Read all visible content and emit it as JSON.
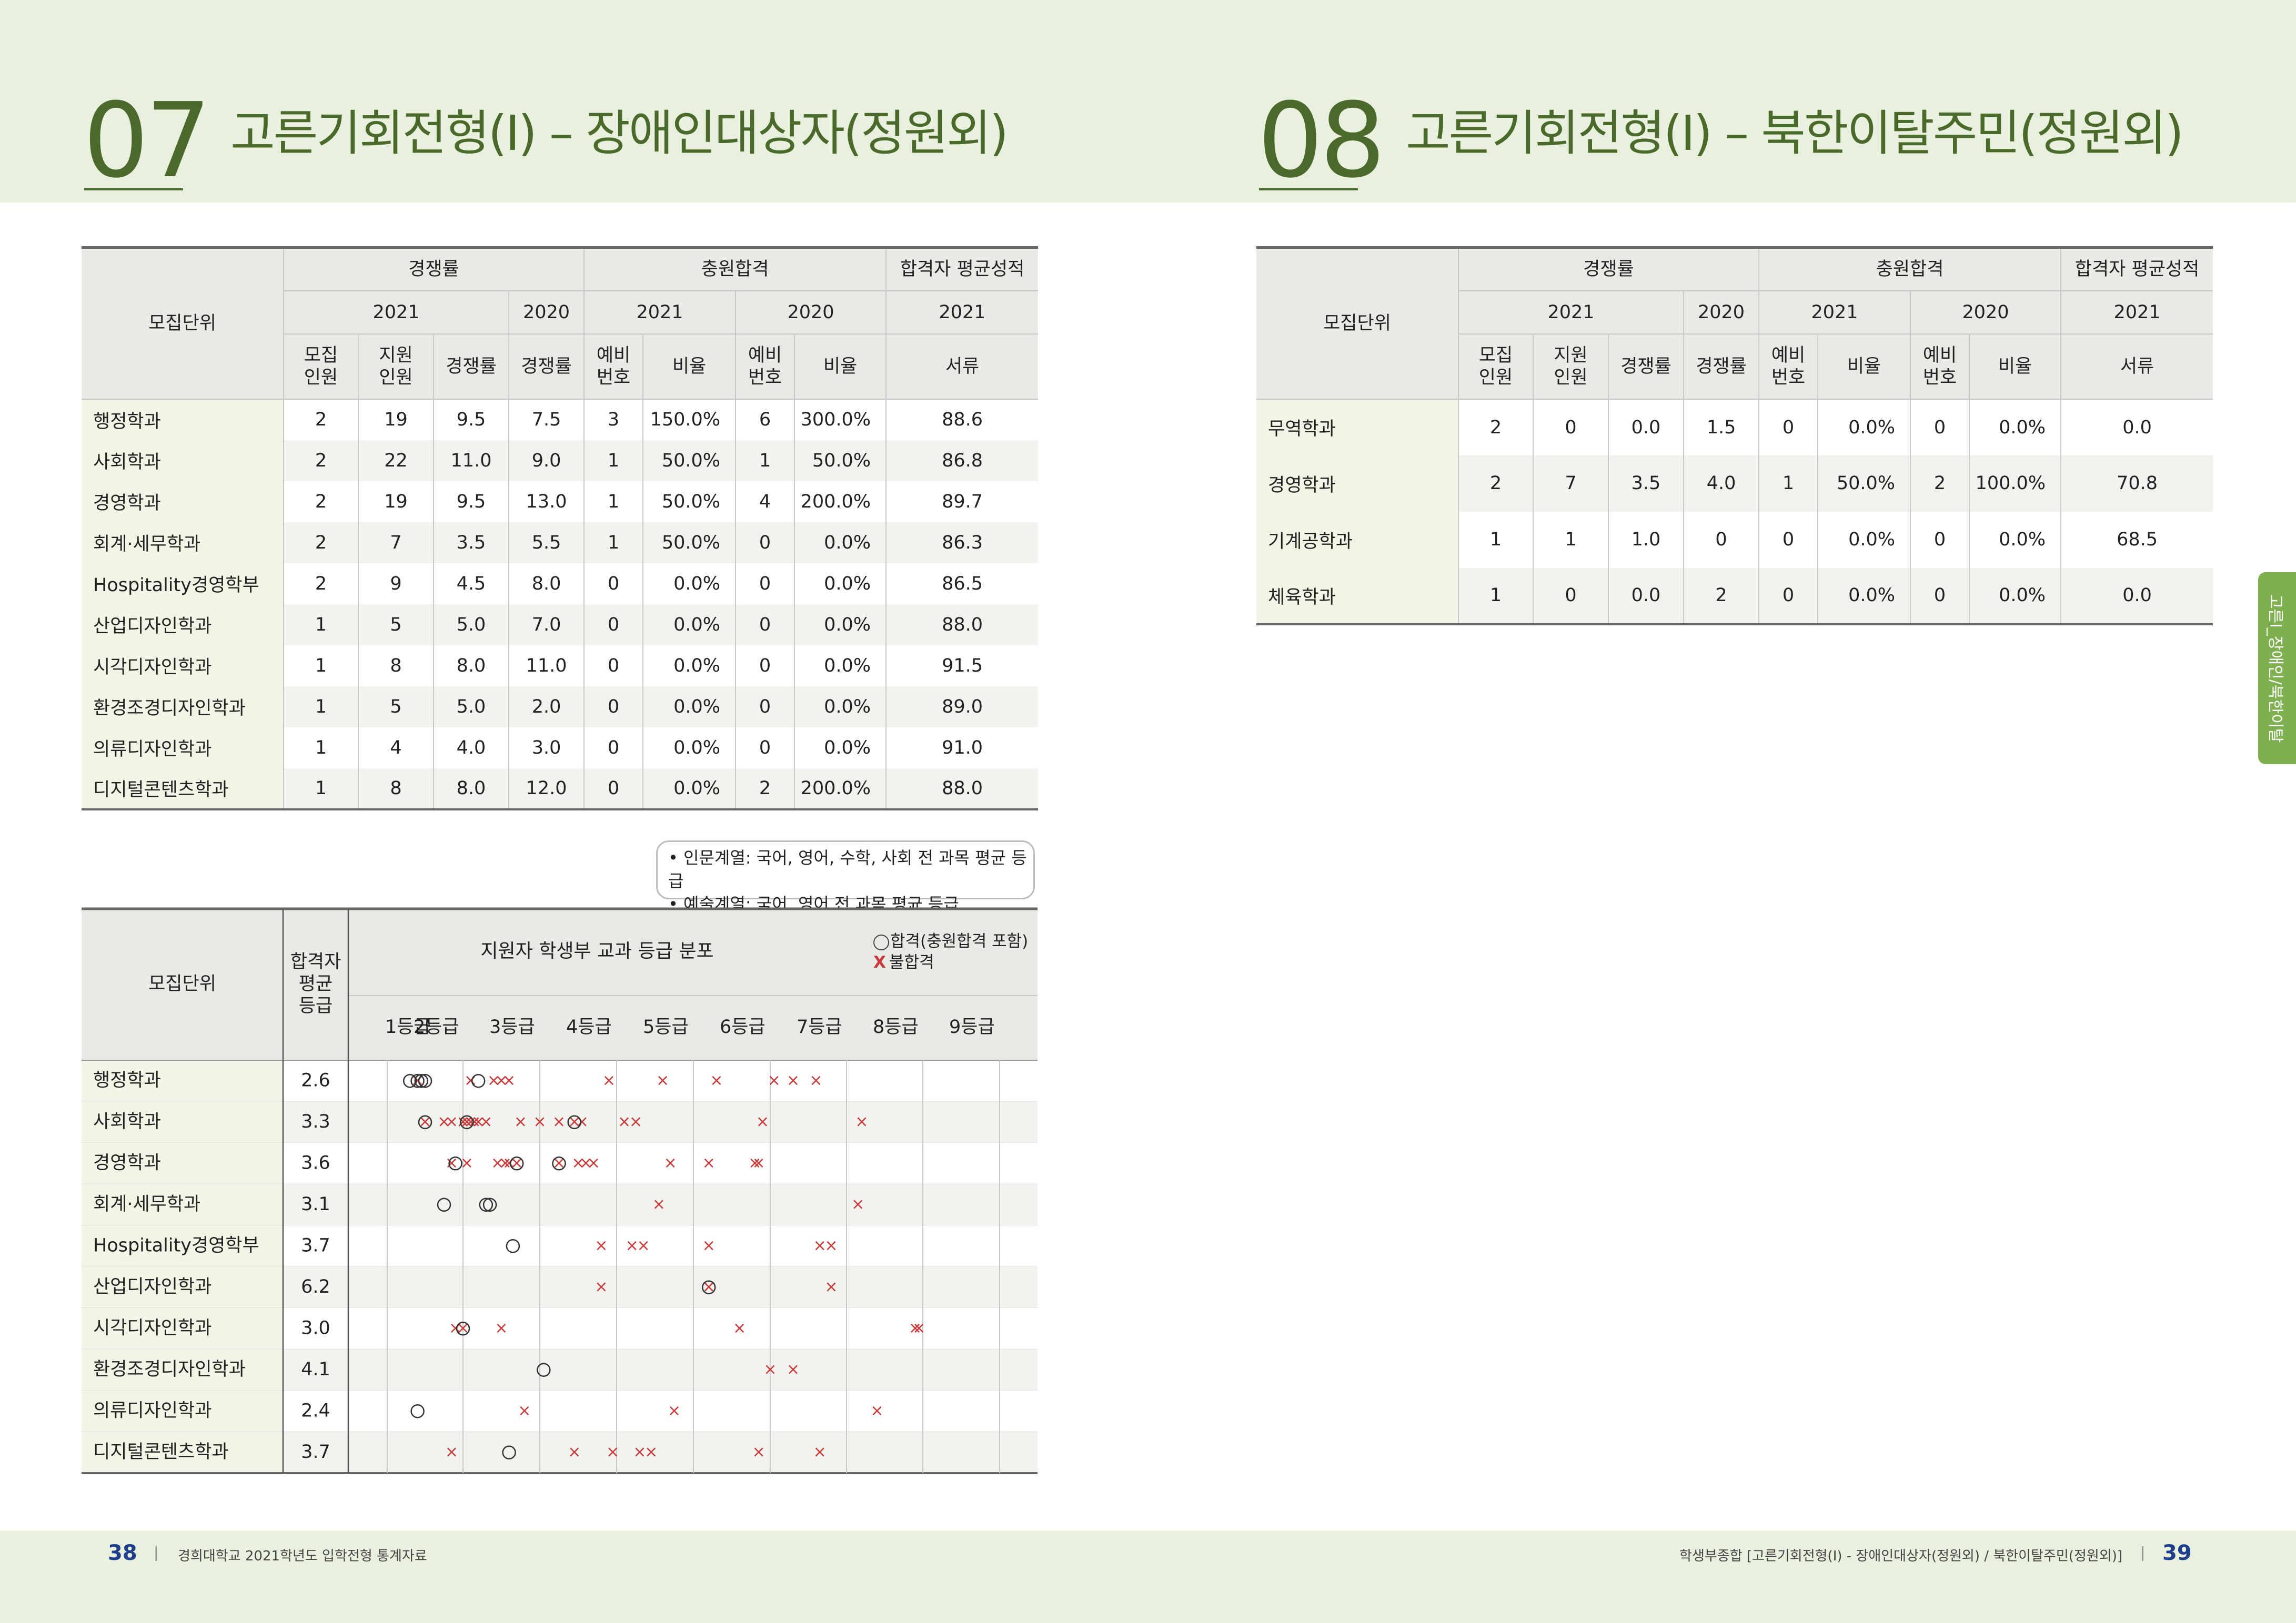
{
  "left_section": {
    "number": "07",
    "title": "고른기회전형(Ⅰ) – 장애인대상자(정원외)"
  },
  "right_section": {
    "number": "08",
    "title": "고른기회전형(Ⅰ) – 북한이탈주민(정원외)"
  },
  "table_headers": {
    "unit": "모집단위",
    "competition": "경쟁률",
    "extra_pass": "충원합격",
    "avg_score": "합격자 평균성적",
    "y2021": "2021",
    "y2020": "2020",
    "recruit": "모집\n인원",
    "applicants": "지원\n인원",
    "ratio": "경쟁률",
    "reserve": "예비\n번호",
    "rate": "비율",
    "docs": "서류"
  },
  "left_table": {
    "rows": [
      [
        "행정학과",
        "2",
        "19",
        "9.5",
        "7.5",
        "3",
        "150.0%",
        "6",
        "300.0%",
        "88.6"
      ],
      [
        "사회학과",
        "2",
        "22",
        "11.0",
        "9.0",
        "1",
        "50.0%",
        "1",
        "50.0%",
        "86.8"
      ],
      [
        "경영학과",
        "2",
        "19",
        "9.5",
        "13.0",
        "1",
        "50.0%",
        "4",
        "200.0%",
        "89.7"
      ],
      [
        "회계·세무학과",
        "2",
        "7",
        "3.5",
        "5.5",
        "1",
        "50.0%",
        "0",
        "0.0%",
        "86.3"
      ],
      [
        "Hospitality경영학부",
        "2",
        "9",
        "4.5",
        "8.0",
        "0",
        "0.0%",
        "0",
        "0.0%",
        "86.5"
      ],
      [
        "산업디자인학과",
        "1",
        "5",
        "5.0",
        "7.0",
        "0",
        "0.0%",
        "0",
        "0.0%",
        "88.0"
      ],
      [
        "시각디자인학과",
        "1",
        "8",
        "8.0",
        "11.0",
        "0",
        "0.0%",
        "0",
        "0.0%",
        "91.5"
      ],
      [
        "환경조경디자인학과",
        "1",
        "5",
        "5.0",
        "2.0",
        "0",
        "0.0%",
        "0",
        "0.0%",
        "89.0"
      ],
      [
        "의류디자인학과",
        "1",
        "4",
        "4.0",
        "3.0",
        "0",
        "0.0%",
        "0",
        "0.0%",
        "91.0"
      ],
      [
        "디지털콘텐츠학과",
        "1",
        "8",
        "8.0",
        "12.0",
        "0",
        "0.0%",
        "2",
        "200.0%",
        "88.0"
      ]
    ]
  },
  "right_table": {
    "rows": [
      [
        "무역학과",
        "2",
        "0",
        "0.0",
        "1.5",
        "0",
        "0.0%",
        "0",
        "0.0%",
        "0.0"
      ],
      [
        "경영학과",
        "2",
        "7",
        "3.5",
        "4.0",
        "1",
        "50.0%",
        "2",
        "100.0%",
        "70.8"
      ],
      [
        "기계공학과",
        "1",
        "1",
        "1.0",
        "0",
        "0",
        "0.0%",
        "0",
        "0.0%",
        "68.5"
      ],
      [
        "체육학과",
        "1",
        "0",
        "0.0",
        "2",
        "0",
        "0.0%",
        "0",
        "0.0%",
        "0.0"
      ]
    ]
  },
  "note": {
    "line1": "• 인문계열: 국어, 영어, 수학, 사회 전 과목 평균 등급",
    "line2": "• 예술계열: 국어, 영어 전 과목 평균 등급"
  },
  "distribution": {
    "header_unit": "모집단위",
    "header_avg": "합격자\n평균\n등급",
    "header_title": "지원자 학생부 교과 등급 분포",
    "legend_pass": "합격(충원합격 포함)",
    "legend_fail": "불합격",
    "legend_fail_mark": "X",
    "grades": [
      "1등급",
      "2등급",
      "3등급",
      "4등급",
      "5등급",
      "6등급",
      "7등급",
      "8등급",
      "9등급"
    ],
    "rows": [
      {
        "name": "행정학과",
        "avg": "2.6",
        "pass": [
          2.3,
          2.4,
          2.45,
          2.5,
          3.2
        ],
        "fail": [
          2.4,
          3.1,
          3.4,
          3.5,
          3.6,
          4.9,
          5.6,
          6.3,
          7.05,
          7.3,
          7.6
        ]
      },
      {
        "name": "사회학과",
        "avg": "3.3",
        "pass": [
          2.5,
          3.05,
          4.45
        ],
        "fail": [
          2.5,
          2.75,
          2.85,
          3.0,
          3.05,
          3.1,
          3.15,
          3.2,
          3.3,
          3.75,
          4.0,
          4.25,
          4.45,
          4.55,
          5.1,
          5.25,
          6.9,
          8.2
        ]
      },
      {
        "name": "경영학과",
        "avg": "3.6",
        "pass": [
          2.9,
          3.7,
          4.25
        ],
        "fail": [
          2.85,
          3.05,
          3.45,
          3.55,
          3.6,
          3.7,
          4.25,
          4.5,
          4.6,
          4.7,
          5.7,
          6.2,
          6.8,
          6.85
        ]
      },
      {
        "name": "회계·세무학과",
        "avg": "3.1",
        "pass": [
          2.75,
          3.3,
          3.35
        ],
        "fail": [
          5.55,
          8.15
        ]
      },
      {
        "name": "Hospitality경영학부",
        "avg": "3.7",
        "pass": [
          3.65
        ],
        "fail": [
          4.8,
          5.2,
          5.35,
          6.2,
          7.65,
          7.8
        ]
      },
      {
        "name": "산업디자인학과",
        "avg": "6.2",
        "pass": [
          6.2
        ],
        "fail": [
          4.8,
          6.2,
          7.8
        ]
      },
      {
        "name": "시각디자인학과",
        "avg": "3.0",
        "pass": [
          3.0
        ],
        "fail": [
          2.9,
          3.0,
          3.5,
          6.6,
          8.9,
          8.95
        ]
      },
      {
        "name": "환경조경디자인학과",
        "avg": "4.1",
        "pass": [
          4.05
        ],
        "fail": [
          7.0,
          7.3
        ]
      },
      {
        "name": "의류디자인학과",
        "avg": "2.4",
        "pass": [
          2.4
        ],
        "fail": [
          3.8,
          5.75,
          8.4
        ]
      },
      {
        "name": "디지털콘텐츠학과",
        "avg": "3.7",
        "pass": [
          3.6
        ],
        "fail": [
          2.85,
          4.45,
          4.95,
          5.3,
          5.45,
          6.85,
          7.65
        ]
      }
    ]
  },
  "side_tab": "고른Ⅰ_장애인/북한이탈",
  "footer": {
    "left_page": "38",
    "left_text": "경희대학교 2021학년도 입학전형 통계자료",
    "right_text": "학생부종합 [고른기회전형(Ⅰ) - 장애인대상자(정원외) / 북한이탈주민(정원외)]",
    "right_page": "39",
    "sep": "|"
  },
  "colors": {
    "accent": "#4a6a2b",
    "tab": "#7fb050",
    "fail": "#c83a3a",
    "page_num": "#1e3f8e"
  }
}
